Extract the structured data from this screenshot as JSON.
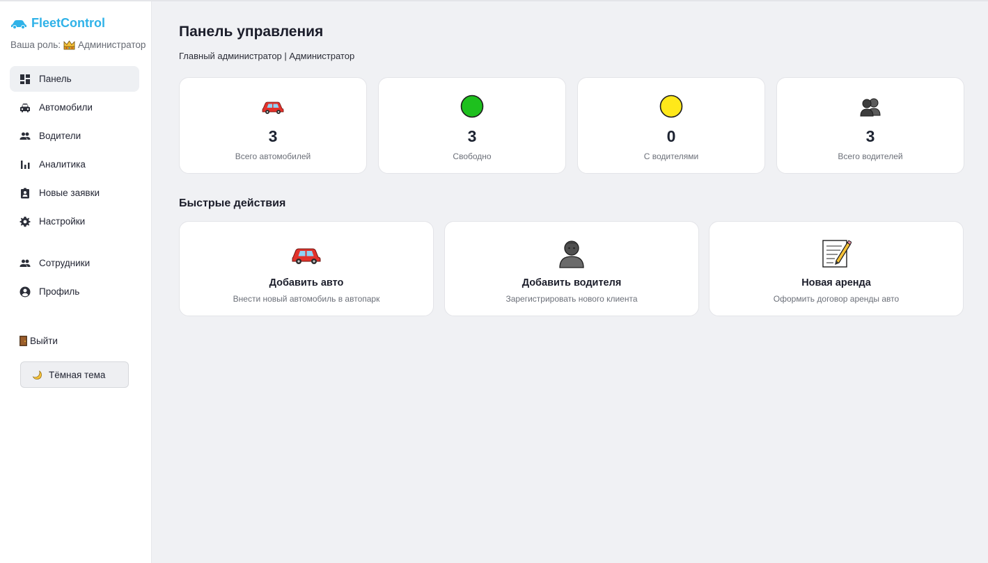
{
  "app": {
    "name": "FleetControl",
    "accent": "#2fb2e8"
  },
  "role": {
    "label": "Ваша роль:",
    "icon": "crown-icon",
    "value": "Администратор"
  },
  "sidebar": {
    "items": [
      {
        "label": "Панель",
        "icon": "dashboard-icon",
        "active": true
      },
      {
        "label": "Автомобили",
        "icon": "car-icon"
      },
      {
        "label": "Водители",
        "icon": "people-icon"
      },
      {
        "label": "Аналитика",
        "icon": "bar-chart-icon"
      },
      {
        "label": "Новые заявки",
        "icon": "clipboard-icon"
      },
      {
        "label": "Настройки",
        "icon": "gear-icon"
      },
      {
        "label": "Сотрудники",
        "icon": "people-icon"
      },
      {
        "label": "Профиль",
        "icon": "account-circle-icon"
      }
    ],
    "logout_label": "Выйти",
    "theme_label": "Тёмная тема"
  },
  "header": {
    "title": "Панель управления",
    "subtitle": "Главный администратор | Администратор"
  },
  "stats": [
    {
      "value": "3",
      "label": "Всего автомобилей",
      "icon": "red-car-icon"
    },
    {
      "value": "3",
      "label": "Свободно",
      "icon": "green-circle-icon",
      "color": "#1ec01e"
    },
    {
      "value": "0",
      "label": "С водителями",
      "icon": "yellow-circle-icon",
      "color": "#ffe81a"
    },
    {
      "value": "3",
      "label": "Всего водителей",
      "icon": "people-silhouette-icon"
    }
  ],
  "quick_actions": {
    "title": "Быстрые действия",
    "items": [
      {
        "title": "Добавить авто",
        "desc": "Внести новый автомобиль в автопарк",
        "icon": "red-car-icon"
      },
      {
        "title": "Добавить водителя",
        "desc": "Зарегистрировать нового клиента",
        "icon": "person-icon"
      },
      {
        "title": "Новая аренда",
        "desc": "Оформить договор аренды авто",
        "icon": "memo-icon"
      }
    ]
  }
}
